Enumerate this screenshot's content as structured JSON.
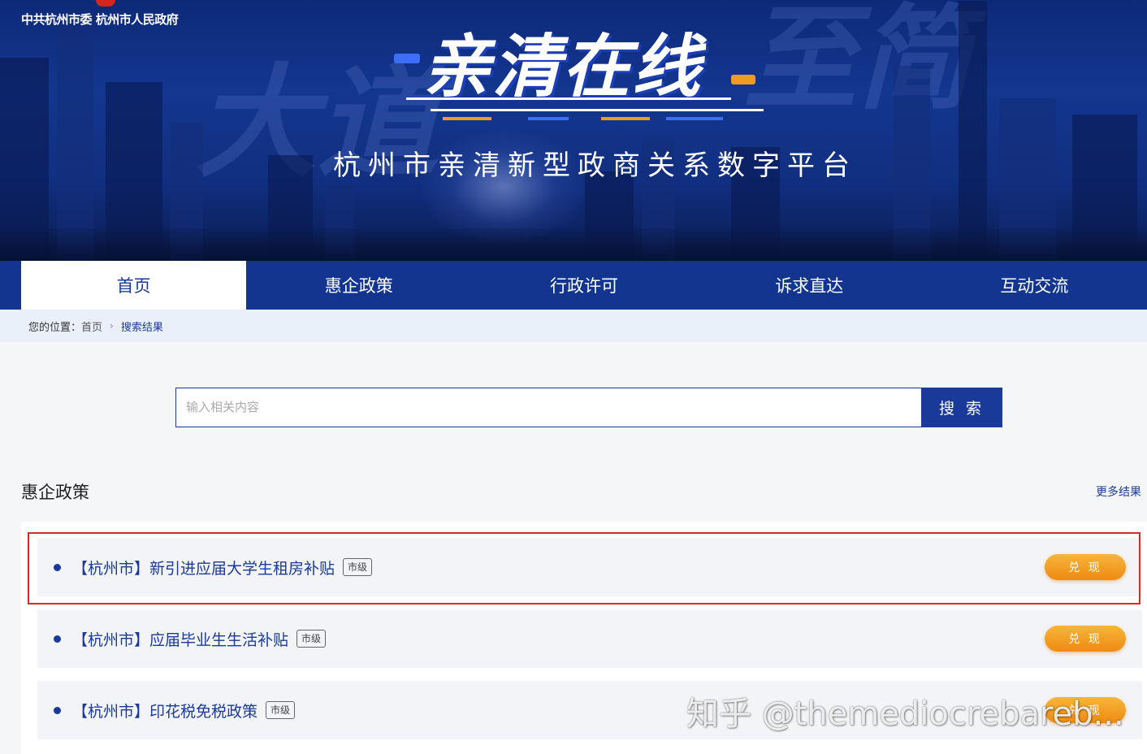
{
  "header": {
    "org_text": "中共杭州市委  杭州市人民政府",
    "brand_title": "亲清在线",
    "subtitle": "杭州市亲清新型政商关系数字平台"
  },
  "nav": {
    "items": [
      {
        "label": "首页",
        "active": true
      },
      {
        "label": "惠企政策",
        "active": false
      },
      {
        "label": "行政许可",
        "active": false
      },
      {
        "label": "诉求直达",
        "active": false
      },
      {
        "label": "互动交流",
        "active": false
      }
    ]
  },
  "breadcrumb": {
    "prefix": "您的位置：",
    "home": "首页",
    "separator": "›",
    "current": "搜索结果"
  },
  "search": {
    "placeholder": "输入相关内容",
    "value": "",
    "button_label": "搜 索"
  },
  "section": {
    "title": "惠企政策",
    "more_label": "更多结果"
  },
  "results": [
    {
      "title": "【杭州市】新引进应届大学生租房补贴",
      "tag": "市级",
      "action": "兑 现"
    },
    {
      "title": "【杭州市】应届毕业生生活补贴",
      "tag": "市级",
      "action": "兑 现"
    },
    {
      "title": "【杭州市】印花税免税政策",
      "tag": "市级",
      "action": "兑 现"
    }
  ],
  "watermark": "知乎 @themediocrebareb...",
  "colors": {
    "primary": "#1a3a9a",
    "nav_bg": "#13348f",
    "accent_orange": "#f09a1e",
    "highlight_red": "#d52b2b"
  }
}
